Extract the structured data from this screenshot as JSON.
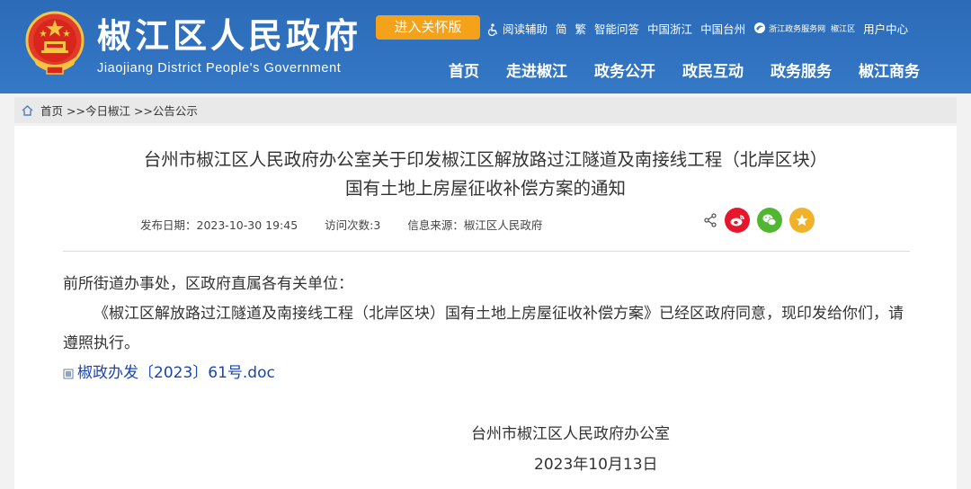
{
  "header": {
    "site_title": "椒江区人民政府",
    "site_subtitle": "Jiaojiang District People's Government",
    "care_button": "进入关怀版",
    "utils": {
      "reading_aid": "阅读辅助",
      "simplified": "简",
      "traditional": "繁",
      "smart_qa": "智能问答",
      "china_zhejiang": "中国浙江",
      "china_taizhou": "中国台州",
      "service_logo": "浙江政务服务网",
      "service_sub": "椒江区",
      "user_center": "用户中心"
    },
    "nav": [
      "首页",
      "走进椒江",
      "政务公开",
      "政民互动",
      "政务服务",
      "椒江商务"
    ]
  },
  "breadcrumb": {
    "home": "首页",
    "level1": ">>今日椒江",
    "level2": ">>公告公示"
  },
  "article": {
    "title_line1": "台州市椒江区人民政府办公室关于印发椒江区解放路过江隧道及南接线工程（北岸区块）",
    "title_line2": "国有土地上房屋征收补偿方案的通知",
    "publish_date": "发布日期：2023-10-30 19:45",
    "visits": "访问次数:3",
    "source": "信息来源：椒江区人民政府",
    "salutation": "前所街道办事处，区政府直属各有关单位：",
    "body": "《椒江区解放路过江隧道及南接线工程（北岸区块）国有土地上房屋征收补偿方案》已经区政府同意，现印发给你们，请遵照执行。",
    "attachment": "椒政办发〔2023〕61号.doc",
    "signature_org": "台州市椒江区人民政府办公室",
    "signature_date": "2023年10月13日"
  },
  "share_icons": [
    "share-icon",
    "weibo-icon",
    "wechat-icon",
    "favorite-icon"
  ],
  "colors": {
    "header_blue": "#2f6fbd",
    "care_orange": "#f4a21a",
    "weibo_red": "#e6162d",
    "wechat_green": "#51b732",
    "favorite_yellow": "#f0b12b",
    "link_blue": "#1a44b0"
  }
}
